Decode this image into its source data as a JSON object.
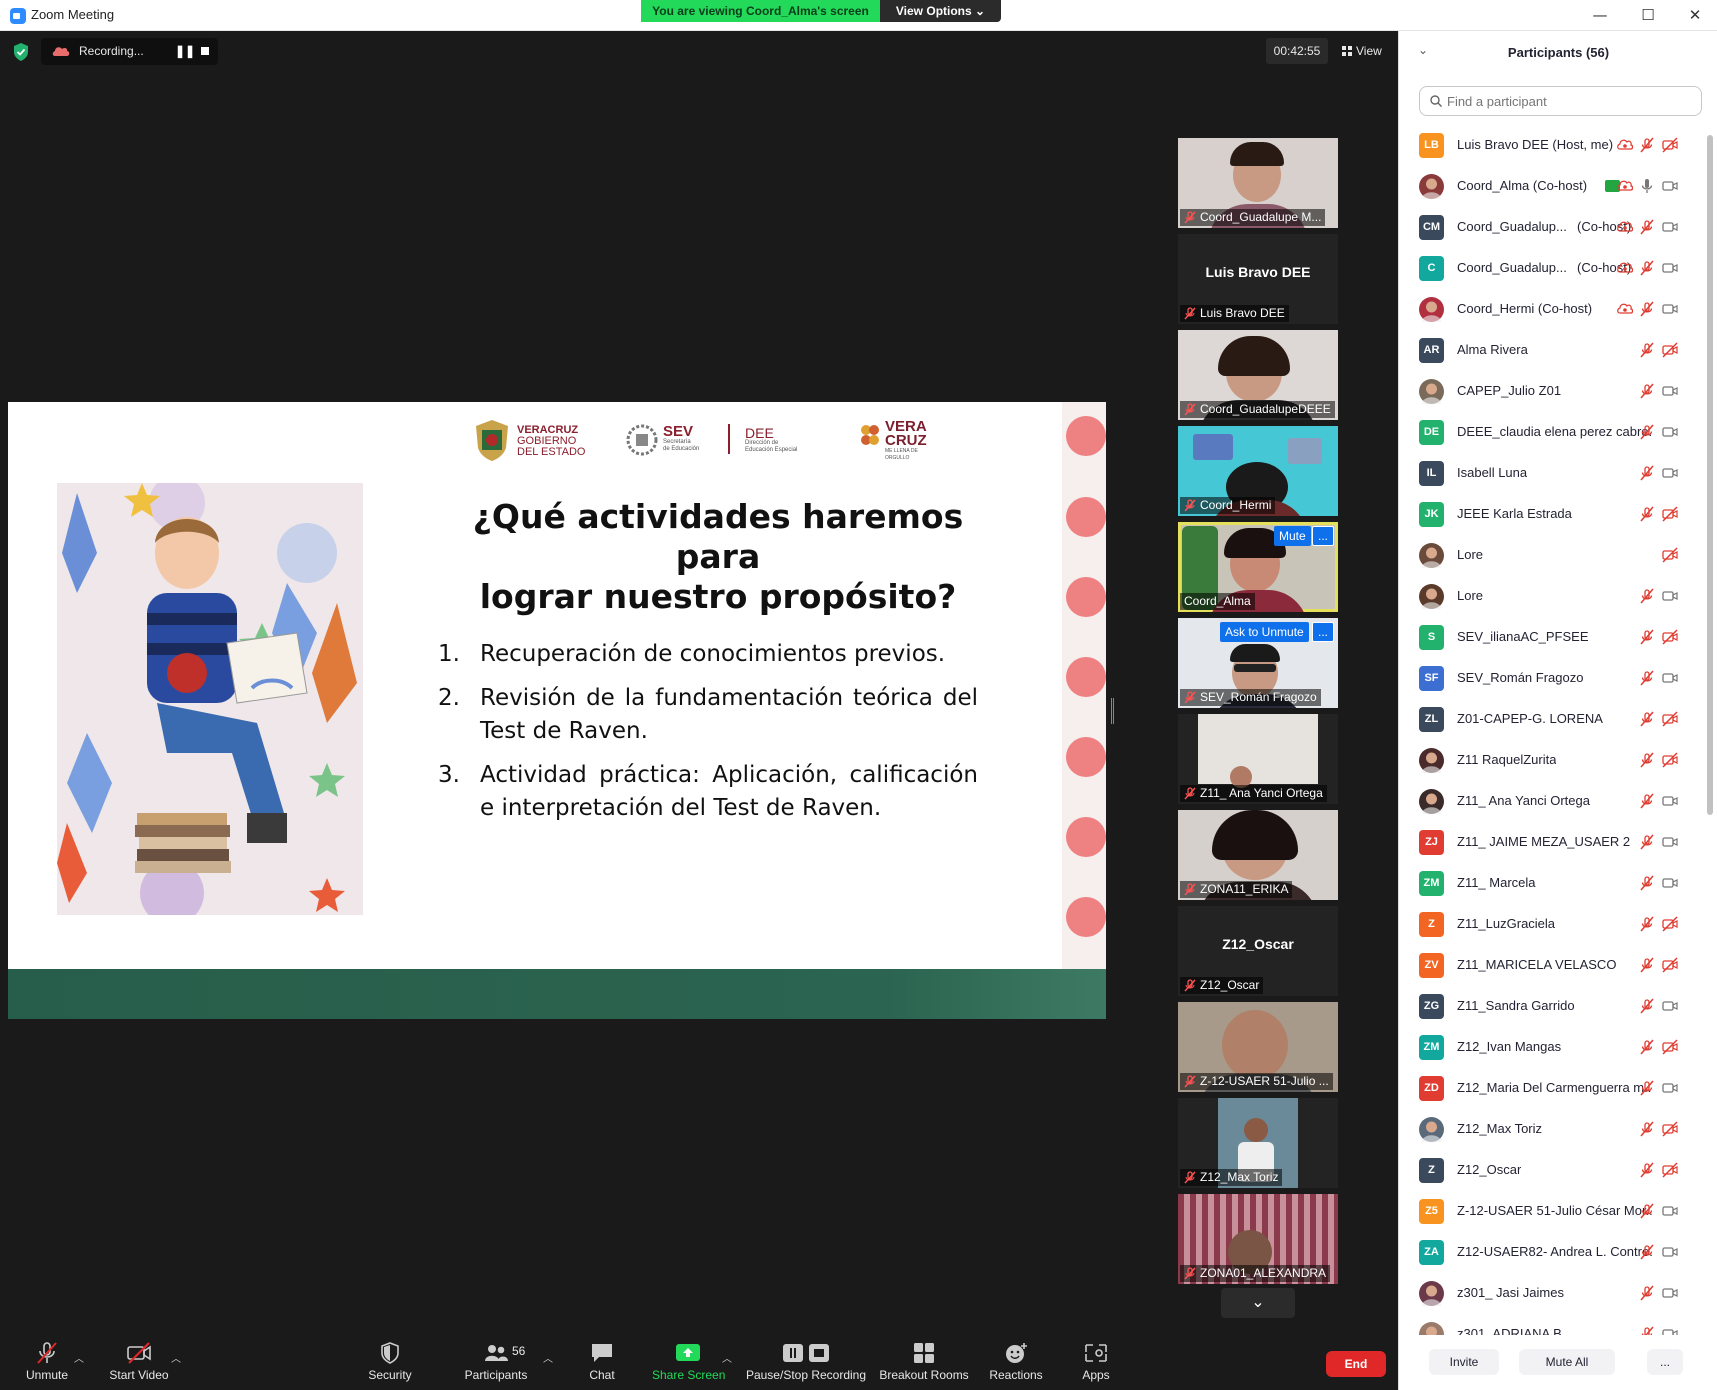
{
  "window": {
    "title": "Zoom Meeting",
    "viewing_banner": "You are viewing Coord_Alma's screen",
    "view_options": "View Options"
  },
  "topbar": {
    "recording_label": "Recording...",
    "timer": "00:42:55",
    "view_label": "View"
  },
  "slide": {
    "logo_veracruz": [
      "VERACRUZ",
      "GOBIERNO",
      "DEL ESTADO"
    ],
    "logo_sev": "SEV",
    "logo_sev_sub": [
      "Secretaría",
      "de Educación"
    ],
    "logo_dee": "DEE",
    "logo_dee_sub": [
      "Dirección de",
      "Educación Especial"
    ],
    "logo_vera": "VERA",
    "logo_cruz": "CRUZ",
    "logo_tagline": "ME LLENA DE ORGULLO",
    "title_line1": "¿Qué actividades haremos para",
    "title_line2": "lograr nuestro propósito?",
    "items": [
      {
        "num": "1.",
        "text": "Recuperación de conocimientos previos."
      },
      {
        "num": "2.",
        "text": "Revisión de la fundamentación teórica del Test de Raven."
      },
      {
        "num": "3.",
        "text": "Actividad práctica: Aplicación, calificación e interpretación del Test de Raven."
      }
    ]
  },
  "tiles": [
    {
      "name": "Coord_Guadalupe M...",
      "type": "video"
    },
    {
      "name": "Luis Bravo DEE",
      "big": "Luis Bravo DEE",
      "type": "name"
    },
    {
      "name": "Coord_GuadalupeDEEE",
      "type": "video"
    },
    {
      "name": "Coord_Hermi",
      "type": "video"
    },
    {
      "name": "Coord_Alma",
      "type": "video",
      "button": "Mute",
      "more": "..."
    },
    {
      "name": "SEV_Román Fragozo",
      "type": "video",
      "button": "Ask to Unmute",
      "more": "..."
    },
    {
      "name": "Z11_ Ana Yanci Ortega",
      "type": "video"
    },
    {
      "name": "ZONA11_ERIKA",
      "type": "video"
    },
    {
      "name": "Z12_Oscar",
      "big": "Z12_Oscar",
      "type": "name"
    },
    {
      "name": "Z-12-USAER 51-Julio ...",
      "type": "video"
    },
    {
      "name": "Z12_Max Toriz",
      "type": "video"
    },
    {
      "name": "ZONA01_ALEXANDRA",
      "type": "video"
    }
  ],
  "toolbar": {
    "unmute": "Unmute",
    "start_video": "Start Video",
    "security": "Security",
    "participants": "Participants",
    "participants_count": "56",
    "chat": "Chat",
    "share_screen": "Share Screen",
    "pause_stop": "Pause/Stop Recording",
    "breakout": "Breakout Rooms",
    "reactions": "Reactions",
    "apps": "Apps",
    "end": "End"
  },
  "panel": {
    "title": "Participants (56)",
    "search_placeholder": "Find a participant",
    "invite": "Invite",
    "mute_all": "Mute All",
    "more": "...",
    "colors": {
      "orange": "#f7931e",
      "dark": "#3a4a5c",
      "teal": "#13a89e",
      "green": "#23b26d",
      "blue": "#3c6fd1",
      "red": "#e03c31"
    },
    "participants": [
      {
        "initials": "LB",
        "color": "#f7931e",
        "name": "Luis Bravo DEE (Host, me)",
        "rec": true,
        "video": "off"
      },
      {
        "initials": "",
        "color": "#8a3a3a",
        "name": "Coord_Alma (Co-host)",
        "photo": true,
        "share": true,
        "rec": true,
        "mic": "on",
        "video": "on"
      },
      {
        "initials": "CM",
        "color": "#3a4a5c",
        "name": "Coord_Guadalup...",
        "role": "(Co-host)",
        "rec": true,
        "video": "on"
      },
      {
        "initials": "C",
        "color": "#13a89e",
        "name": "Coord_Guadalup...",
        "role": "(Co-host)",
        "rec": true,
        "video": "on"
      },
      {
        "initials": "",
        "color": "#b03040",
        "name": "Coord_Hermi (Co-host)",
        "photo": true,
        "rec": true,
        "video": "on"
      },
      {
        "initials": "AR",
        "color": "#3a4a5c",
        "name": "Alma Rivera",
        "video": "off"
      },
      {
        "initials": "",
        "color": "#7a6a5a",
        "name": "CAPEP_Julio Z01",
        "photo": true,
        "video": "on"
      },
      {
        "initials": "DE",
        "color": "#23b26d",
        "name": "DEEE_claudia elena perez cabre...",
        "video": "on"
      },
      {
        "initials": "IL",
        "color": "#3a4a5c",
        "name": "Isabell Luna",
        "video": "on"
      },
      {
        "initials": "JK",
        "color": "#23b26d",
        "name": "JEEE Karla Estrada",
        "video": "off"
      },
      {
        "initials": "",
        "color": "#6a4a3a",
        "name": "Lore",
        "photo": true,
        "micless": true,
        "video": "off"
      },
      {
        "initials": "",
        "color": "#5a3a2a",
        "name": "Lore",
        "photo": true,
        "video": "on"
      },
      {
        "initials": "S",
        "color": "#23b26d",
        "name": "SEV_ilianaAC_PFSEE",
        "video": "off"
      },
      {
        "initials": "SF",
        "color": "#3c6fd1",
        "name": "SEV_Román Fragozo",
        "video": "on"
      },
      {
        "initials": "ZL",
        "color": "#3a4a5c",
        "name": "Z01-CAPEP-G. LORENA",
        "video": "off"
      },
      {
        "initials": "",
        "color": "#4a2a2a",
        "name": "Z11 RaquelZurita",
        "photo": true,
        "video": "off"
      },
      {
        "initials": "",
        "color": "#3a2a2a",
        "name": "Z11_ Ana Yanci Ortega",
        "photo": true,
        "video": "on"
      },
      {
        "initials": "ZJ",
        "color": "#e03c31",
        "name": "Z11_ JAIME MEZA_USAER 2",
        "video": "on"
      },
      {
        "initials": "ZM",
        "color": "#23b26d",
        "name": "Z11_ Marcela",
        "video": "on"
      },
      {
        "initials": "Z",
        "color": "#f26522",
        "name": "Z11_LuzGraciela",
        "video": "off"
      },
      {
        "initials": "ZV",
        "color": "#f26522",
        "name": "Z11_MARICELA VELASCO",
        "video": "off"
      },
      {
        "initials": "ZG",
        "color": "#3a4a5c",
        "name": "Z11_Sandra Garrido",
        "video": "on"
      },
      {
        "initials": "ZM",
        "color": "#13a89e",
        "name": "Z12_Ivan Mangas",
        "video": "off"
      },
      {
        "initials": "ZD",
        "color": "#e03c31",
        "name": "Z12_Maria Del Carmenguerra m...",
        "video": "on"
      },
      {
        "initials": "",
        "color": "#5a6a7a",
        "name": "Z12_Max Toriz",
        "photo": true,
        "video": "off"
      },
      {
        "initials": "Z",
        "color": "#3a4a5c",
        "name": "Z12_Oscar",
        "video": "off"
      },
      {
        "initials": "Z5",
        "color": "#f7931e",
        "name": "Z-12-USAER 51-Julio César Mor...",
        "video": "on"
      },
      {
        "initials": "ZA",
        "color": "#13a89e",
        "name": "Z12-USAER82- Andrea L. Contre...",
        "video": "on"
      },
      {
        "initials": "",
        "color": "#6a3a4a",
        "name": "z301_ Jasi Jaimes",
        "photo": true,
        "video": "on"
      },
      {
        "initials": "",
        "color": "#9a7a6a",
        "name": "z301_ADRIANA B.",
        "photo": true,
        "video": "on"
      }
    ]
  }
}
